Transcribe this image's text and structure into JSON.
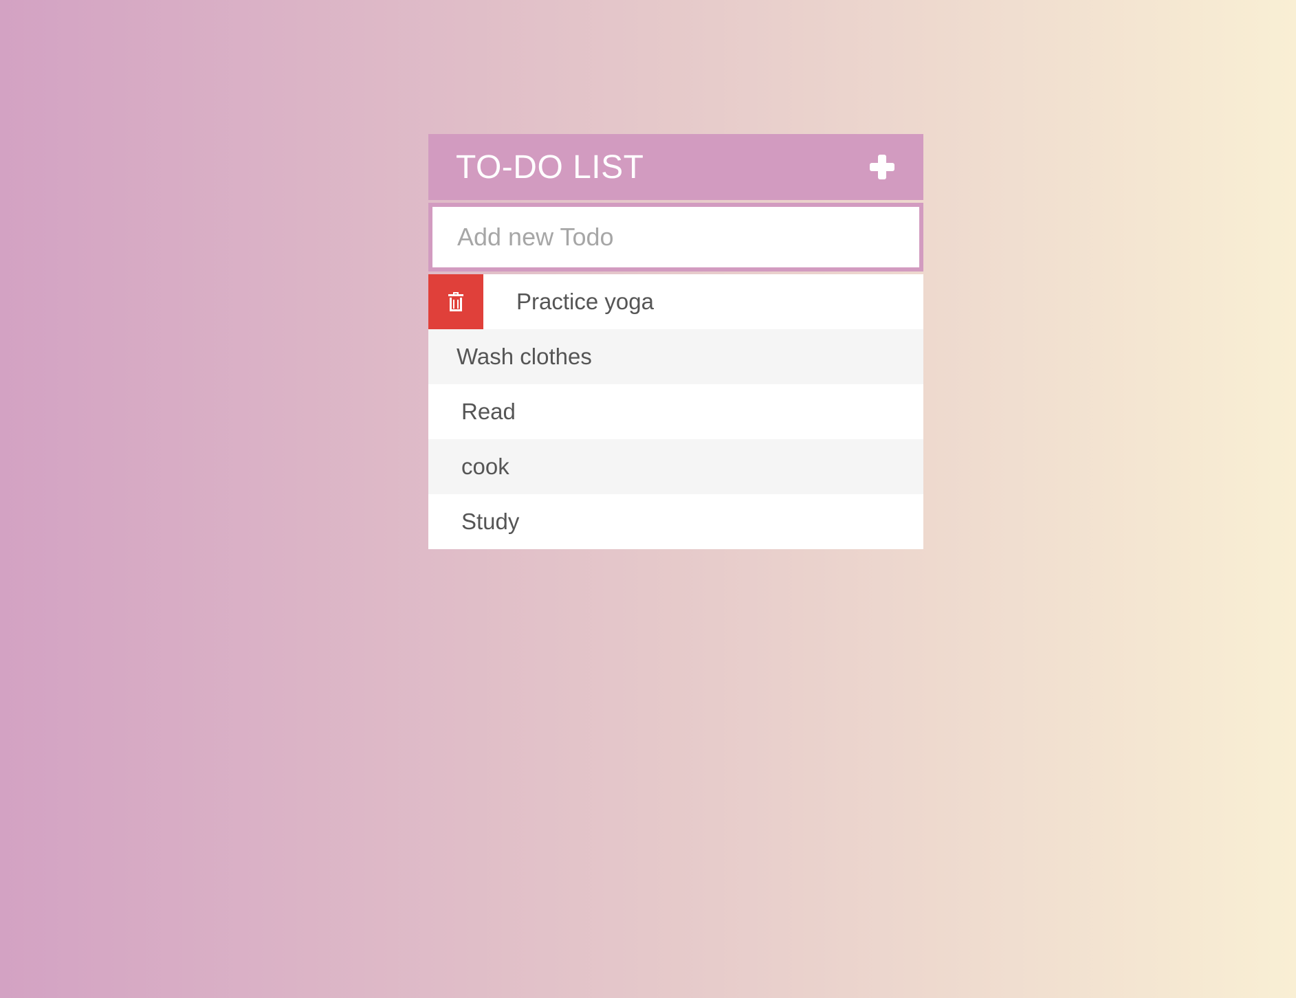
{
  "header": {
    "title": "TO-DO LIST",
    "add_icon": "plus-icon"
  },
  "input": {
    "placeholder": "Add new Todo",
    "value": ""
  },
  "todos": [
    {
      "label": "Practice yoga",
      "delete_icon": "trash-icon",
      "delete_visible": true
    },
    {
      "label": "Wash clothes"
    },
    {
      "label": "Read"
    },
    {
      "label": "cook"
    },
    {
      "label": "Study"
    }
  ],
  "colors": {
    "header": "#d29bc0",
    "delete": "#e0403a",
    "text": "#555555"
  }
}
